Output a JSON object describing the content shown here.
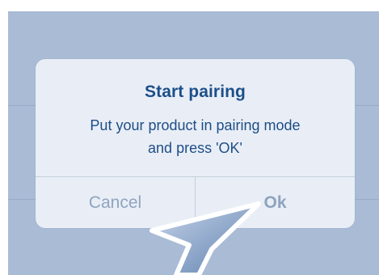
{
  "dialog": {
    "title": "Start pairing",
    "message": "Put your product in pairing mode\nand press 'OK'",
    "cancel_label": "Cancel",
    "ok_label": "Ok"
  },
  "colors": {
    "backdrop": "#a9bbd5",
    "dialog_background": "#e9eef6",
    "title_text": "#1d4f8a",
    "button_text": "#8fa4c0"
  },
  "icons": {
    "pointer": "arrow-pointer-icon"
  }
}
